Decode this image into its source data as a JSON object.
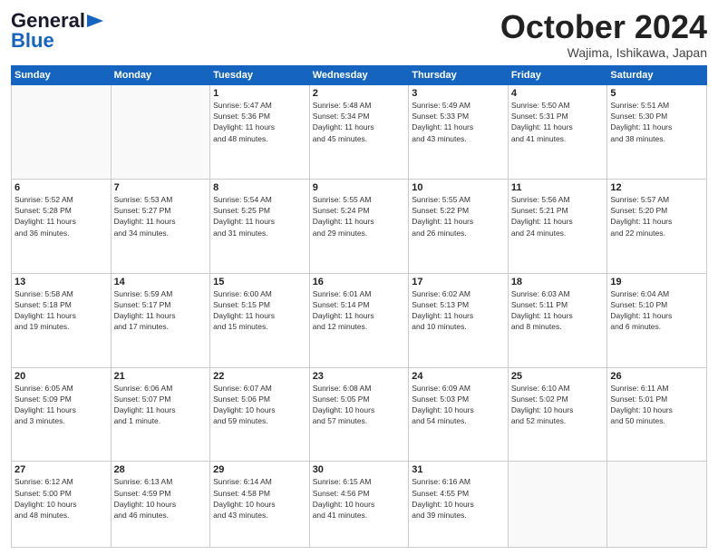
{
  "header": {
    "logo_line1": "General",
    "logo_line2": "Blue",
    "month": "October 2024",
    "location": "Wajima, Ishikawa, Japan"
  },
  "days_of_week": [
    "Sunday",
    "Monday",
    "Tuesday",
    "Wednesday",
    "Thursday",
    "Friday",
    "Saturday"
  ],
  "weeks": [
    [
      {
        "day": "",
        "info": ""
      },
      {
        "day": "",
        "info": ""
      },
      {
        "day": "1",
        "info": "Sunrise: 5:47 AM\nSunset: 5:36 PM\nDaylight: 11 hours\nand 48 minutes."
      },
      {
        "day": "2",
        "info": "Sunrise: 5:48 AM\nSunset: 5:34 PM\nDaylight: 11 hours\nand 45 minutes."
      },
      {
        "day": "3",
        "info": "Sunrise: 5:49 AM\nSunset: 5:33 PM\nDaylight: 11 hours\nand 43 minutes."
      },
      {
        "day": "4",
        "info": "Sunrise: 5:50 AM\nSunset: 5:31 PM\nDaylight: 11 hours\nand 41 minutes."
      },
      {
        "day": "5",
        "info": "Sunrise: 5:51 AM\nSunset: 5:30 PM\nDaylight: 11 hours\nand 38 minutes."
      }
    ],
    [
      {
        "day": "6",
        "info": "Sunrise: 5:52 AM\nSunset: 5:28 PM\nDaylight: 11 hours\nand 36 minutes."
      },
      {
        "day": "7",
        "info": "Sunrise: 5:53 AM\nSunset: 5:27 PM\nDaylight: 11 hours\nand 34 minutes."
      },
      {
        "day": "8",
        "info": "Sunrise: 5:54 AM\nSunset: 5:25 PM\nDaylight: 11 hours\nand 31 minutes."
      },
      {
        "day": "9",
        "info": "Sunrise: 5:55 AM\nSunset: 5:24 PM\nDaylight: 11 hours\nand 29 minutes."
      },
      {
        "day": "10",
        "info": "Sunrise: 5:55 AM\nSunset: 5:22 PM\nDaylight: 11 hours\nand 26 minutes."
      },
      {
        "day": "11",
        "info": "Sunrise: 5:56 AM\nSunset: 5:21 PM\nDaylight: 11 hours\nand 24 minutes."
      },
      {
        "day": "12",
        "info": "Sunrise: 5:57 AM\nSunset: 5:20 PM\nDaylight: 11 hours\nand 22 minutes."
      }
    ],
    [
      {
        "day": "13",
        "info": "Sunrise: 5:58 AM\nSunset: 5:18 PM\nDaylight: 11 hours\nand 19 minutes."
      },
      {
        "day": "14",
        "info": "Sunrise: 5:59 AM\nSunset: 5:17 PM\nDaylight: 11 hours\nand 17 minutes."
      },
      {
        "day": "15",
        "info": "Sunrise: 6:00 AM\nSunset: 5:15 PM\nDaylight: 11 hours\nand 15 minutes."
      },
      {
        "day": "16",
        "info": "Sunrise: 6:01 AM\nSunset: 5:14 PM\nDaylight: 11 hours\nand 12 minutes."
      },
      {
        "day": "17",
        "info": "Sunrise: 6:02 AM\nSunset: 5:13 PM\nDaylight: 11 hours\nand 10 minutes."
      },
      {
        "day": "18",
        "info": "Sunrise: 6:03 AM\nSunset: 5:11 PM\nDaylight: 11 hours\nand 8 minutes."
      },
      {
        "day": "19",
        "info": "Sunrise: 6:04 AM\nSunset: 5:10 PM\nDaylight: 11 hours\nand 6 minutes."
      }
    ],
    [
      {
        "day": "20",
        "info": "Sunrise: 6:05 AM\nSunset: 5:09 PM\nDaylight: 11 hours\nand 3 minutes."
      },
      {
        "day": "21",
        "info": "Sunrise: 6:06 AM\nSunset: 5:07 PM\nDaylight: 11 hours\nand 1 minute."
      },
      {
        "day": "22",
        "info": "Sunrise: 6:07 AM\nSunset: 5:06 PM\nDaylight: 10 hours\nand 59 minutes."
      },
      {
        "day": "23",
        "info": "Sunrise: 6:08 AM\nSunset: 5:05 PM\nDaylight: 10 hours\nand 57 minutes."
      },
      {
        "day": "24",
        "info": "Sunrise: 6:09 AM\nSunset: 5:03 PM\nDaylight: 10 hours\nand 54 minutes."
      },
      {
        "day": "25",
        "info": "Sunrise: 6:10 AM\nSunset: 5:02 PM\nDaylight: 10 hours\nand 52 minutes."
      },
      {
        "day": "26",
        "info": "Sunrise: 6:11 AM\nSunset: 5:01 PM\nDaylight: 10 hours\nand 50 minutes."
      }
    ],
    [
      {
        "day": "27",
        "info": "Sunrise: 6:12 AM\nSunset: 5:00 PM\nDaylight: 10 hours\nand 48 minutes."
      },
      {
        "day": "28",
        "info": "Sunrise: 6:13 AM\nSunset: 4:59 PM\nDaylight: 10 hours\nand 46 minutes."
      },
      {
        "day": "29",
        "info": "Sunrise: 6:14 AM\nSunset: 4:58 PM\nDaylight: 10 hours\nand 43 minutes."
      },
      {
        "day": "30",
        "info": "Sunrise: 6:15 AM\nSunset: 4:56 PM\nDaylight: 10 hours\nand 41 minutes."
      },
      {
        "day": "31",
        "info": "Sunrise: 6:16 AM\nSunset: 4:55 PM\nDaylight: 10 hours\nand 39 minutes."
      },
      {
        "day": "",
        "info": ""
      },
      {
        "day": "",
        "info": ""
      }
    ]
  ]
}
